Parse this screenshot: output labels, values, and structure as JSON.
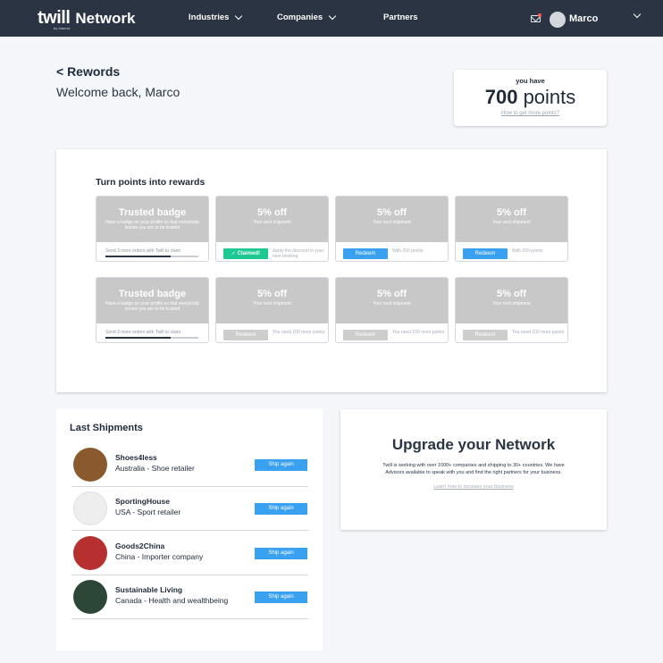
{
  "nav": {
    "brand": "twill",
    "brand_suffix": "Network",
    "brand_sub": "by Maersk",
    "items": [
      {
        "label": "Industries"
      },
      {
        "label": "Companies"
      },
      {
        "label": "Partners"
      }
    ],
    "user_name": "Marco",
    "icons": [
      "mail-icon",
      "avatar",
      "chevron-down-icon"
    ]
  },
  "header": {
    "back_title": "< Rewords",
    "welcome": "Welcome back, Marco"
  },
  "points": {
    "label": "you have",
    "value": "700",
    "unit": "points",
    "link": "How to get more points?"
  },
  "rewards": {
    "title": "Turn points into rewards",
    "rows": [
      [
        {
          "type": "badge",
          "title": "Trusted badge",
          "subtitle": "Have a badge on your profile so that everybody knows you are to be trusted",
          "note": "Send 3 more orders with Twill to claim",
          "progress": 0.7
        },
        {
          "type": "offer",
          "title": "5% off",
          "subtitle": "Your next shipment",
          "button": "✓ Claimed!",
          "button_style": "claimed",
          "note": "Apply the discount in your next booking"
        },
        {
          "type": "offer",
          "title": "5% off",
          "subtitle": "Your next shipment",
          "button": "Redeem",
          "button_style": "redeem",
          "note": "With 200 points"
        },
        {
          "type": "offer",
          "title": "5% off",
          "subtitle": "Your next shipment",
          "button": "Redeem",
          "button_style": "redeem",
          "note": "With 200 points"
        }
      ],
      [
        {
          "type": "badge",
          "title": "Trusted badge",
          "subtitle": "Have a badge on your profile so that everybody knows you are to be trusted",
          "note": "Send 3 more orders with Twill to claim",
          "progress": 0.7
        },
        {
          "type": "offer",
          "title": "5% off",
          "subtitle": "Your next shipment",
          "button": "Redeem",
          "button_style": "disabled",
          "note": "You need 100 more points"
        },
        {
          "type": "offer",
          "title": "5% off",
          "subtitle": "Your next shipment",
          "button": "Redeem",
          "button_style": "disabled",
          "note": "You need 100 more points"
        },
        {
          "type": "offer",
          "title": "5% off",
          "subtitle": "Your next shipment",
          "button": "Redeem",
          "button_style": "disabled",
          "note": "You need 100 more points"
        }
      ]
    ]
  },
  "shipments": {
    "title": "Last Shipments",
    "button_label": "Ship again",
    "items": [
      {
        "name": "Shoes4less",
        "desc": "Australia - Shoe retailer",
        "avatar_color": "#8a5a2e"
      },
      {
        "name": "SportingHouse",
        "desc": "USA - Sport retailer",
        "avatar_color": "#eeeeee"
      },
      {
        "name": "Goods2China",
        "desc": "China - Importer company",
        "avatar_color": "#b5302f"
      },
      {
        "name": "Sustainable Living",
        "desc": "Canada - Health and wealthbeing",
        "avatar_color": "#2c4638"
      }
    ]
  },
  "upgrade": {
    "title": "Upgrade your Network",
    "body": "Twill is working with over 1000+ companies and shipping to 30+ countries. We have Advisors available to speak with you and find the right partners for your business.",
    "link": "Learn how to increase your business"
  },
  "colors": {
    "nav_bg": "#2b3443",
    "claimed": "#1dc893",
    "redeem": "#3aa0f0",
    "card_header": "#c8c8c8"
  }
}
